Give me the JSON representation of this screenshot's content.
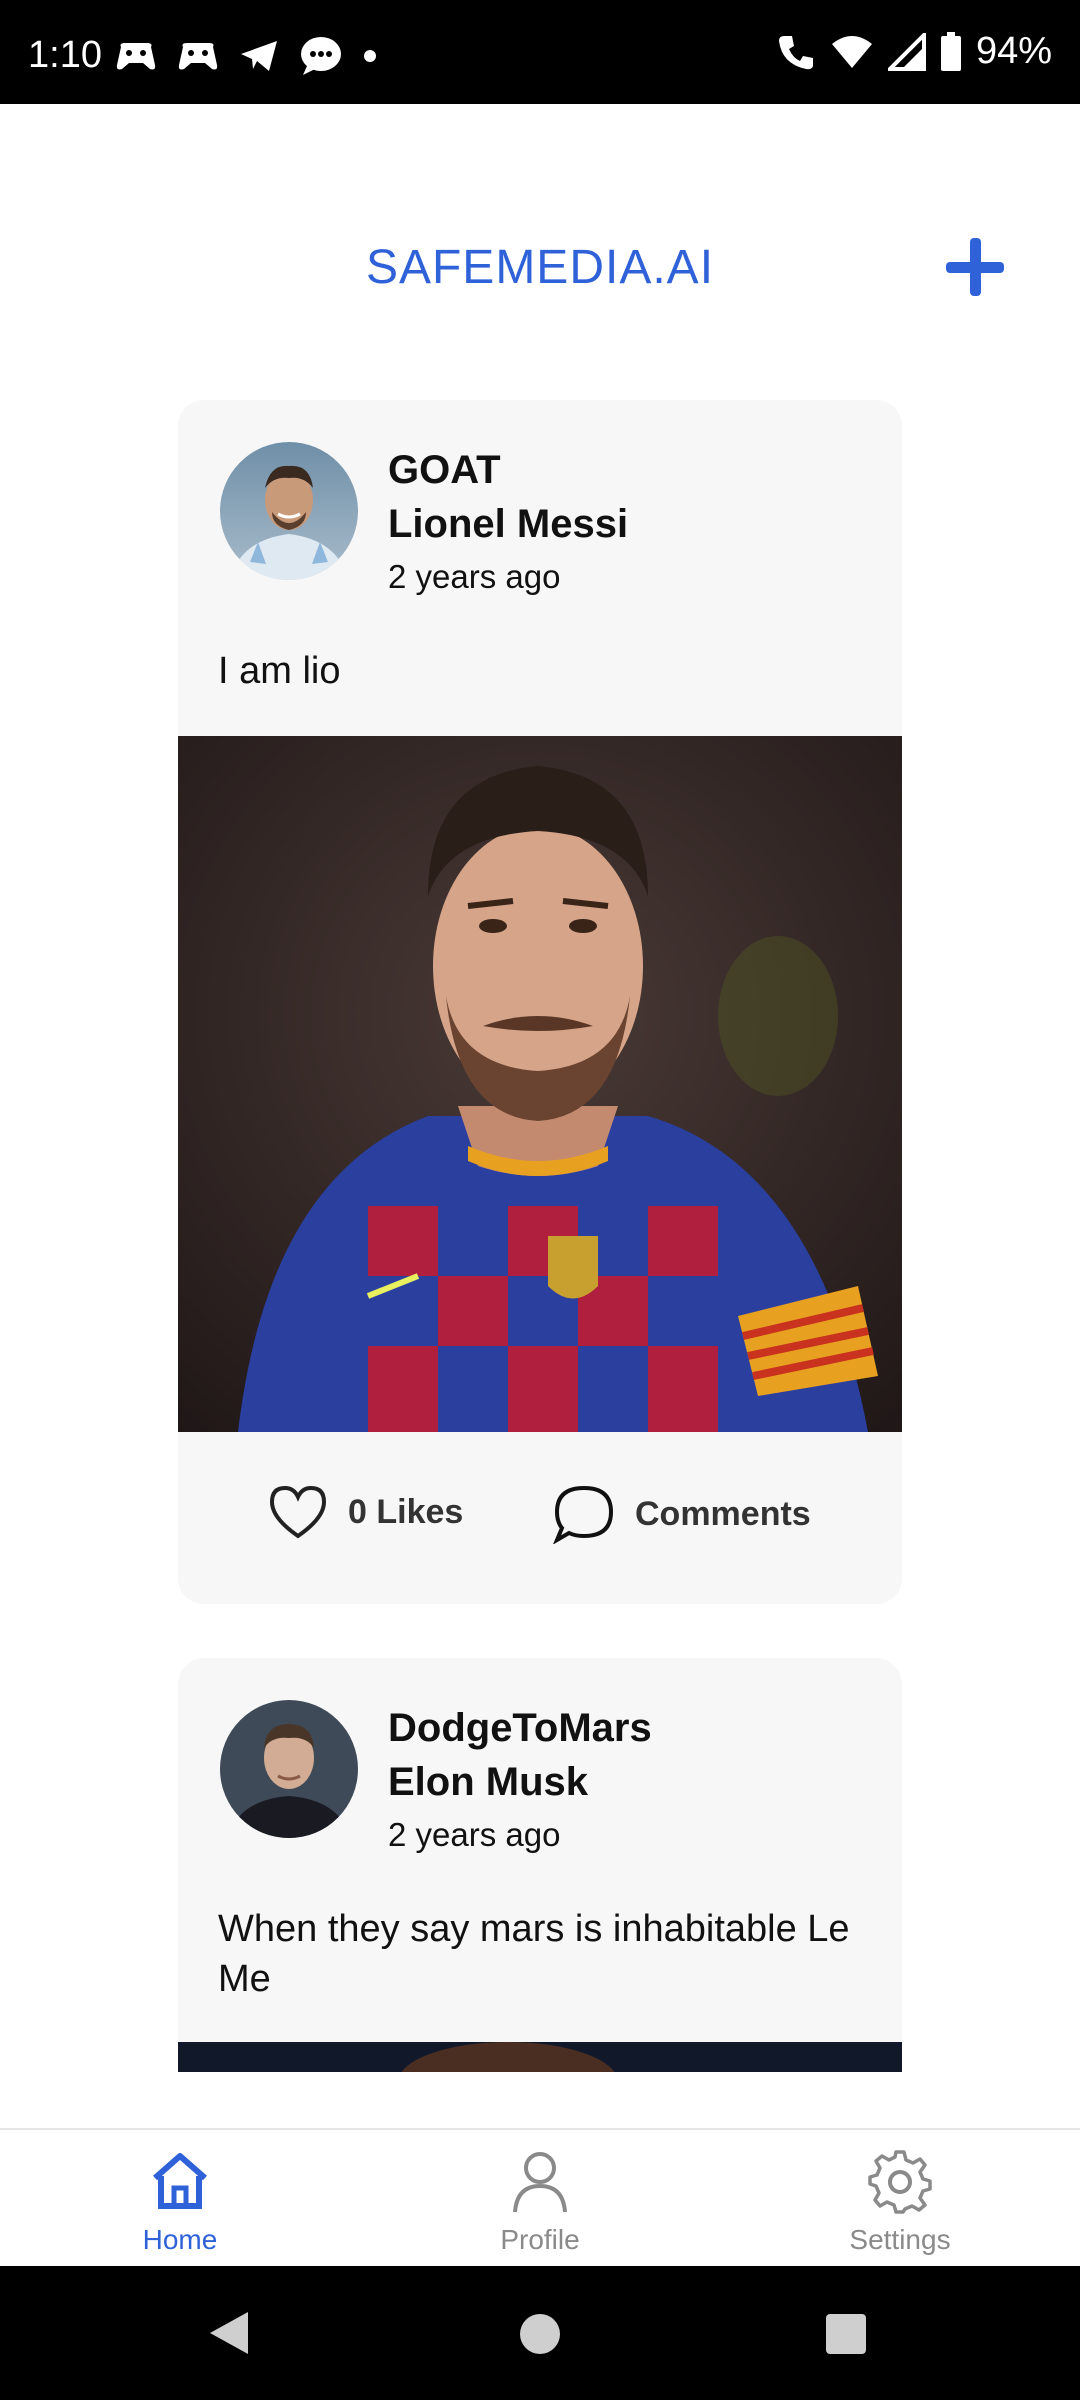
{
  "status_bar": {
    "time": "1:10",
    "battery": "94%",
    "left_icons": [
      "game-controller-icon",
      "game-controller-icon",
      "telegram-icon",
      "chat-bubble-icon",
      "dot-icon"
    ],
    "right_icons": [
      "wifi-call-icon",
      "wifi-icon",
      "signal-icon",
      "battery-icon"
    ]
  },
  "header": {
    "title": "SAFEMEDIA.AI",
    "add_icon": "plus-icon",
    "accent_color": "#2f62d8"
  },
  "posts": [
    {
      "username": "GOAT",
      "fullname": "Lionel Messi",
      "timestamp": "2 years ago",
      "text": "I am lio",
      "likes_label": "0 Likes",
      "comments_label": "Comments"
    },
    {
      "username": "DodgeToMars",
      "fullname": "Elon Musk",
      "timestamp": "2 years ago",
      "text": "When they say mars is inhabitable Le Me"
    }
  ],
  "bottom_nav": {
    "items": [
      {
        "label": "Home",
        "icon": "home-icon",
        "active": true
      },
      {
        "label": "Profile",
        "icon": "user-icon",
        "active": false
      },
      {
        "label": "Settings",
        "icon": "gear-icon",
        "active": false
      }
    ]
  },
  "colors": {
    "accent": "#2f62d8",
    "card_bg": "#f7f7f7",
    "inactive": "#8a8a8a"
  }
}
